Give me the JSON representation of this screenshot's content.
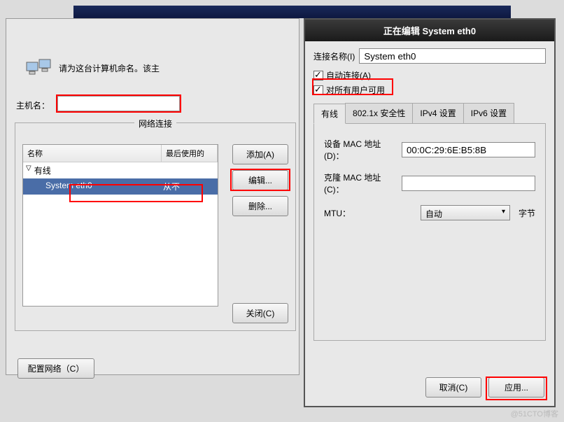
{
  "main": {
    "prompt": "请为这台计算机命名。该主",
    "hostname_label": "主机名：",
    "network_frame_title": "网络连接",
    "list_columns": {
      "name": "名称",
      "last_used": "最后使用的"
    },
    "category": "有线",
    "selected_connection": {
      "name": "System eth0",
      "last": "从不"
    },
    "buttons": {
      "add": "添加(A)",
      "edit": "编辑...",
      "delete": "删除...",
      "close": "关闭(C)"
    },
    "config_network_btn": "配置网络（C）"
  },
  "dialog": {
    "title": "正在编辑 System eth0",
    "conn_name_label": "连接名称(I)",
    "conn_name_value": "System eth0",
    "auto_connect": "自动连接(A)",
    "all_users": "对所有用户可用",
    "tabs": {
      "wired": "有线",
      "security": "802.1x 安全性",
      "ipv4": "IPv4 设置",
      "ipv6": "IPv6 设置"
    },
    "form": {
      "device_mac_label": "设备 MAC 地址(D)：",
      "device_mac_value": "00:0C:29:6E:B5:8B",
      "clone_mac_label": "克隆 MAC 地址(C)：",
      "clone_mac_value": "",
      "mtu_label": "MTU：",
      "mtu_value": "自动",
      "mtu_unit": "字节"
    },
    "footer": {
      "cancel": "取消(C)",
      "apply": "应用..."
    }
  },
  "watermark": "@51CTO博客"
}
